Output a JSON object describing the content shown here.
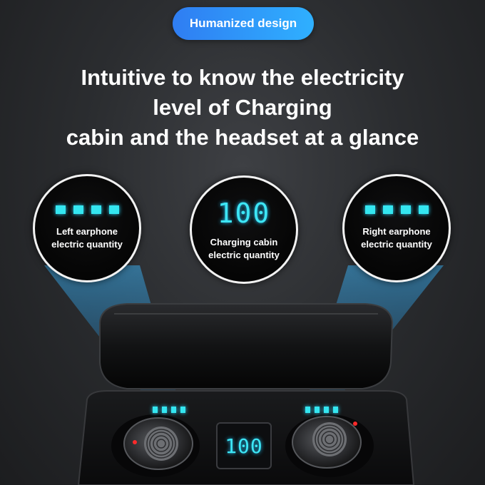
{
  "banner": {
    "label": "Humanized design"
  },
  "headline": {
    "lines": [
      "Intuitive to know the electricity",
      "level of Charging",
      "cabin and the headset at a glance"
    ]
  },
  "callouts": {
    "left": {
      "line1": "Left earphone",
      "line2": "electric quantity",
      "level_bars": 4
    },
    "center": {
      "reading": "100",
      "line1": "Charging cabin",
      "line2": "electric quantity"
    },
    "right": {
      "line1": "Right earphone",
      "line2": "electric quantity",
      "level_bars": 4
    }
  },
  "case_display": {
    "reading": "100"
  },
  "colors": {
    "accent": "#34e6f0",
    "banner_start": "#2f7df2",
    "banner_end": "#2fb0ff"
  }
}
